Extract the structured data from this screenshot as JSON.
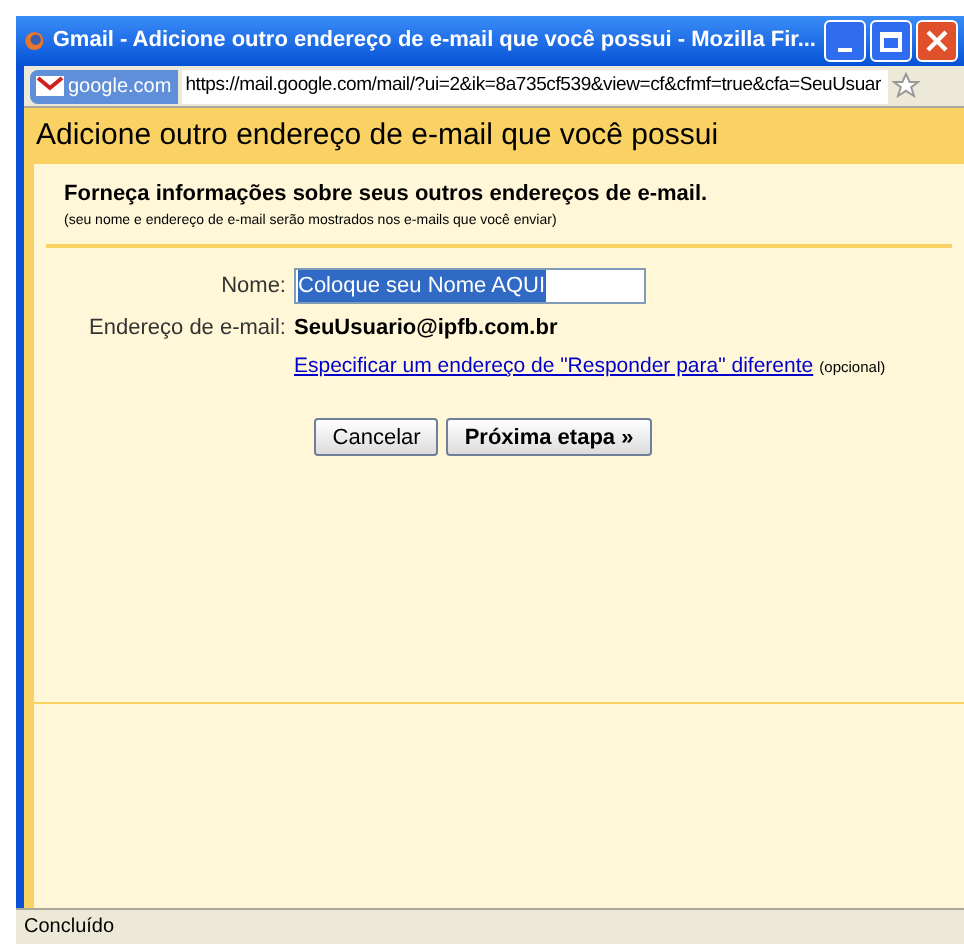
{
  "window": {
    "title": "Gmail - Adicione outro endereço de e-mail que você possui - Mozilla Fir..."
  },
  "address_bar": {
    "site": "google.com",
    "url": "https://mail.google.com/mail/?ui=2&ik=8a735cf539&view=cf&cfmf=true&cfa=SeuUsuar"
  },
  "page": {
    "heading": "Adicione outro endereço de e-mail que você possui",
    "intro_title": "Forneça informações sobre seus outros endereços de e-mail.",
    "intro_note": "(seu nome e endereço de e-mail serão mostrados nos e-mails que você enviar)",
    "name_label": "Nome:",
    "name_value": "Coloque seu Nome AQUI",
    "email_label": "Endereço de e-mail:",
    "email_value": "SeuUsuario@ipfb.com.br",
    "reply_to_link": "Especificar um endereço de \"Responder para\" diferente",
    "reply_to_note": "(opcional)",
    "buttons": [
      {
        "label": "Cancelar",
        "kind": "secondary"
      },
      {
        "label": "Próxima etapa »",
        "kind": "primary"
      }
    ]
  },
  "status_bar": {
    "text": "Concluído"
  }
}
